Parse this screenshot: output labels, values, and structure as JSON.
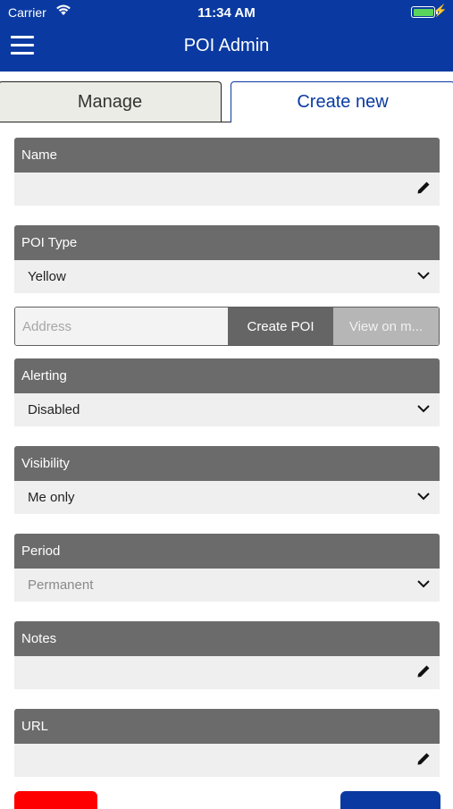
{
  "status": {
    "carrier": "Carrier",
    "time": "11:34 AM",
    "battery_level": 1.0
  },
  "header": {
    "title": "POI Admin"
  },
  "tabs": [
    {
      "label": "Manage",
      "active": false
    },
    {
      "label": "Create new",
      "active": true
    }
  ],
  "form": {
    "name": {
      "label": "Name",
      "value": ""
    },
    "poi_type": {
      "label": "POI Type",
      "value": "Yellow"
    },
    "address": {
      "placeholder": "Address",
      "create_label": "Create POI",
      "view_label": "View on m..."
    },
    "alerting": {
      "label": "Alerting",
      "value": "Disabled"
    },
    "visibility": {
      "label": "Visibility",
      "value": "Me only"
    },
    "period": {
      "label": "Period",
      "value": "Permanent"
    },
    "notes": {
      "label": "Notes",
      "value": ""
    },
    "url": {
      "label": "URL",
      "value": ""
    }
  },
  "colors": {
    "brand": "#0a3aa1",
    "section_header": "#6b6b6b",
    "field_bg": "#efefef",
    "danger": "#ff0000"
  },
  "icons": {
    "menu": "hamburger-icon",
    "wifi": "wifi-icon",
    "battery": "battery-icon",
    "edit": "pencil-icon",
    "dropdown": "chevron-down-icon"
  }
}
